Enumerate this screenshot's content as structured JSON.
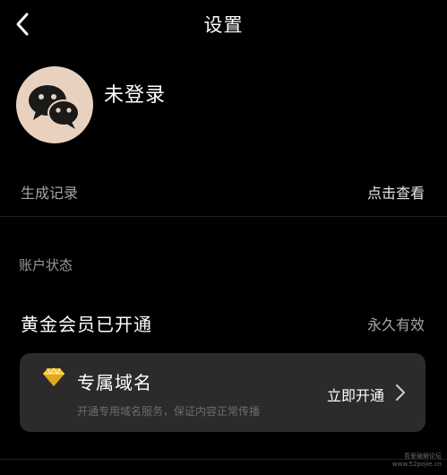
{
  "header": {
    "title": "设置",
    "back_icon": "chevron-left-icon"
  },
  "profile": {
    "avatar_icon": "wechat-icon",
    "avatar_bg": "#e8d2bf",
    "login_status": "未登录"
  },
  "history": {
    "label": "生成记录",
    "action": "点击查看"
  },
  "account": {
    "section_title": "账户状态",
    "member_label": "黄金会员已开通",
    "member_value": "永久有效"
  },
  "domain_card": {
    "icon": "gem-icon",
    "icon_color": "#f5c12a",
    "title": "专属域名",
    "description": "开通专用域名服务，保证内容正常传播",
    "action": "立即开通"
  },
  "watermark": {
    "line1": "吾爱破解论坛",
    "line2": "www.52pojie.cn"
  }
}
